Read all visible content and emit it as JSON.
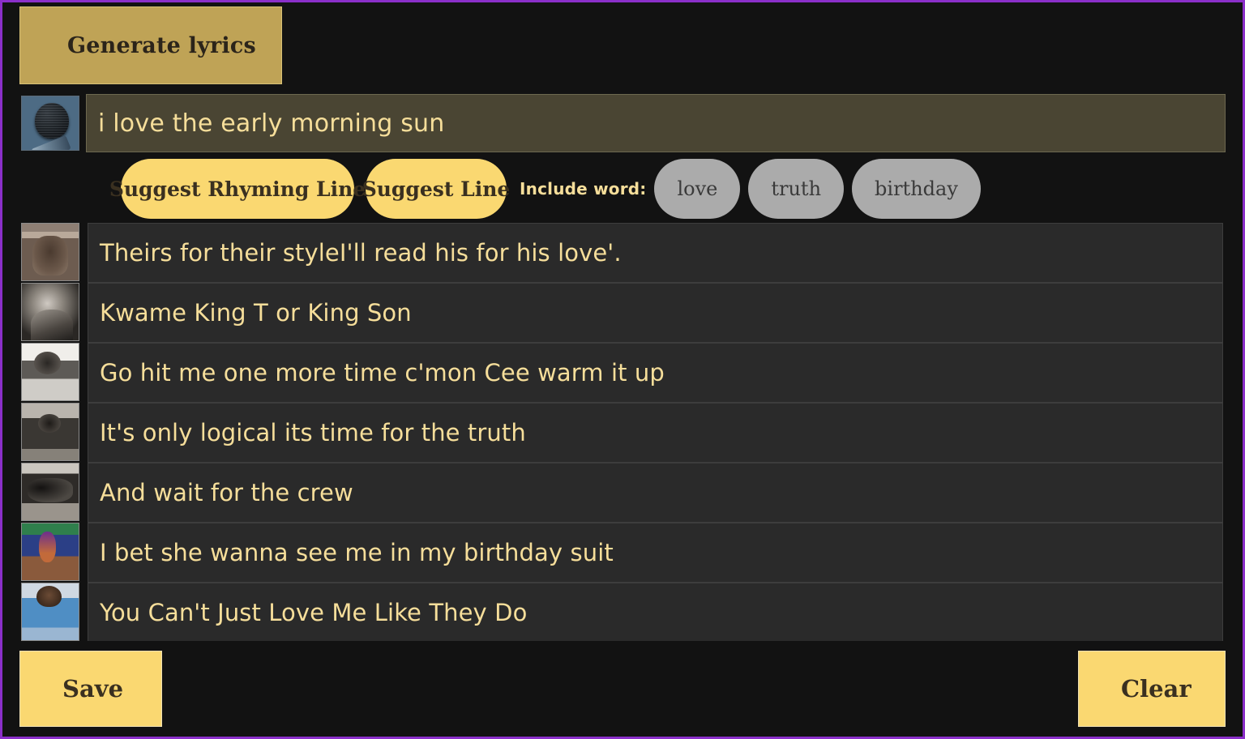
{
  "app": {
    "frame_border_color": "#8B2FC9",
    "background_color": "#121212"
  },
  "toolbar": {
    "generate_label": "Generate lyrics",
    "generate_bg": "#BFA356"
  },
  "prompt": {
    "icon": "microphone-icon",
    "value": "i love the early morning sun",
    "placeholder": "i love the early morning sun",
    "field_bg": "#4A4533",
    "text_color": "#F6DE9A"
  },
  "actions": {
    "suggest_rhyming_label": "Suggest Rhyming Line",
    "suggest_line_label": "Suggest Line",
    "include_word_label": "Include word:",
    "pill_bg": "#FAD871",
    "word_pill_bg": "#ABABAB",
    "words": [
      {
        "label": "love"
      },
      {
        "label": "truth"
      },
      {
        "label": "birthday"
      }
    ]
  },
  "lyrics": {
    "rows": [
      {
        "text": "Theirs for their styleI'll read his for his love'.",
        "thumb": "shakespeare-book-thumbnail"
      },
      {
        "text": "Kwame King T or King Son",
        "thumb": "artist-portrait-thumbnail"
      },
      {
        "text": "Go hit me one more time c'mon Cee warm it up",
        "thumb": "artist-chain-thumbnail"
      },
      {
        "text": "It's only logical its time for the truth",
        "thumb": "artist-seated-thumbnail"
      },
      {
        "text": "And wait for the crew",
        "thumb": "crew-group-thumbnail"
      },
      {
        "text": "I bet she wanna see me in my birthday suit",
        "thumb": "color-group-thumbnail"
      },
      {
        "text": "You Can't Just Love Me Like They Do",
        "thumb": "blue-shirt-portrait-thumbnail"
      }
    ],
    "row_bg": "#2A2A2A",
    "text_color": "#F6DE9A"
  },
  "footer": {
    "save_label": "Save",
    "clear_label": "Clear",
    "button_bg": "#FAD871"
  }
}
